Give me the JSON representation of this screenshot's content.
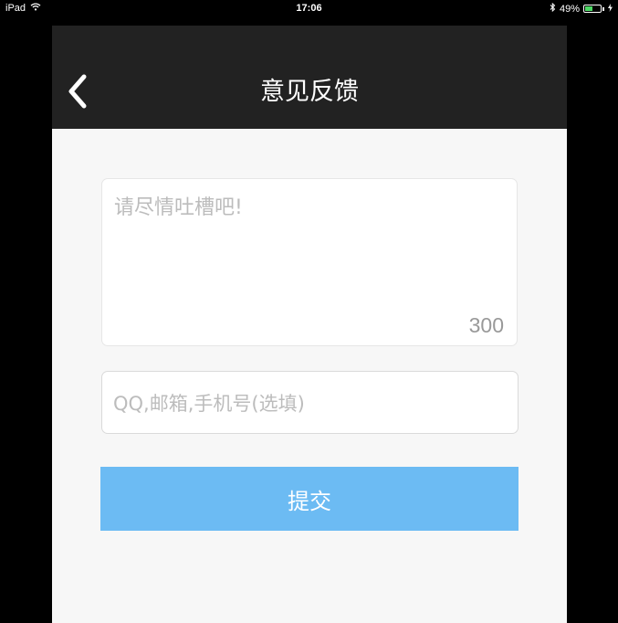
{
  "status_bar": {
    "device": "iPad",
    "time": "17:06",
    "battery": "49%",
    "battery_level": 0.49
  },
  "nav": {
    "title": "意见反馈"
  },
  "feedback": {
    "placeholder": "请尽情吐槽吧!",
    "char_limit": "300"
  },
  "contact": {
    "placeholder": "QQ,邮箱,手机号(选填)"
  },
  "submit": {
    "label": "提交"
  },
  "colors": {
    "nav_background": "#222222",
    "page_background": "#f7f7f7",
    "submit_background": "#6cbbf3",
    "placeholder_text": "#bcbcbc",
    "battery_fill": "#4cd964"
  }
}
